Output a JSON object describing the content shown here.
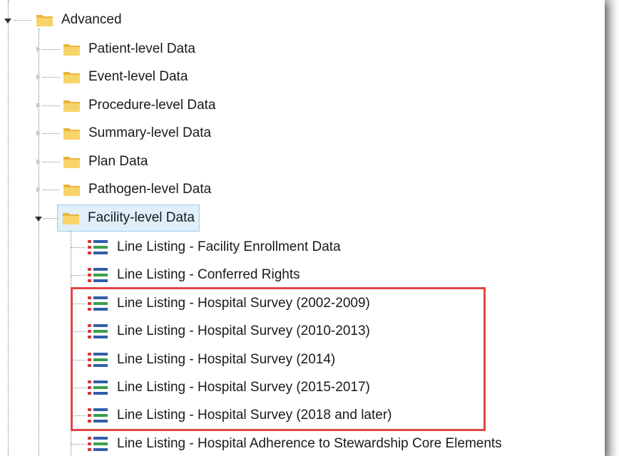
{
  "tree": {
    "root": {
      "label": "Advanced",
      "expanded": true
    },
    "folders": [
      {
        "label": "Patient-level Data",
        "expanded": false
      },
      {
        "label": "Event-level Data",
        "expanded": false
      },
      {
        "label": "Procedure-level Data",
        "expanded": false
      },
      {
        "label": "Summary-level Data",
        "expanded": false
      },
      {
        "label": "Plan Data",
        "expanded": false
      },
      {
        "label": "Pathogen-level Data",
        "expanded": false
      },
      {
        "label": "Facility-level Data",
        "expanded": true,
        "selected": true
      }
    ],
    "reports": [
      {
        "label": "Line Listing - Facility Enrollment Data"
      },
      {
        "label": "Line Listing - Conferred Rights"
      },
      {
        "label": "Line Listing - Hospital Survey (2002-2009)"
      },
      {
        "label": "Line Listing - Hospital Survey (2010-2013)"
      },
      {
        "label": "Line Listing - Hospital Survey (2014)"
      },
      {
        "label": "Line Listing - Hospital Survey (2015-2017)"
      },
      {
        "label": "Line Listing - Hospital Survey (2018 and later)"
      },
      {
        "label": "Line Listing - Hospital Adherence to Stewardship Core Elements"
      }
    ]
  },
  "icons": {
    "folder": "folder-icon",
    "report": "line-listing-icon"
  },
  "colors": {
    "highlight_border": "#e04545",
    "selected_bg": "#dff0fb",
    "folder": "#f5c84c"
  }
}
